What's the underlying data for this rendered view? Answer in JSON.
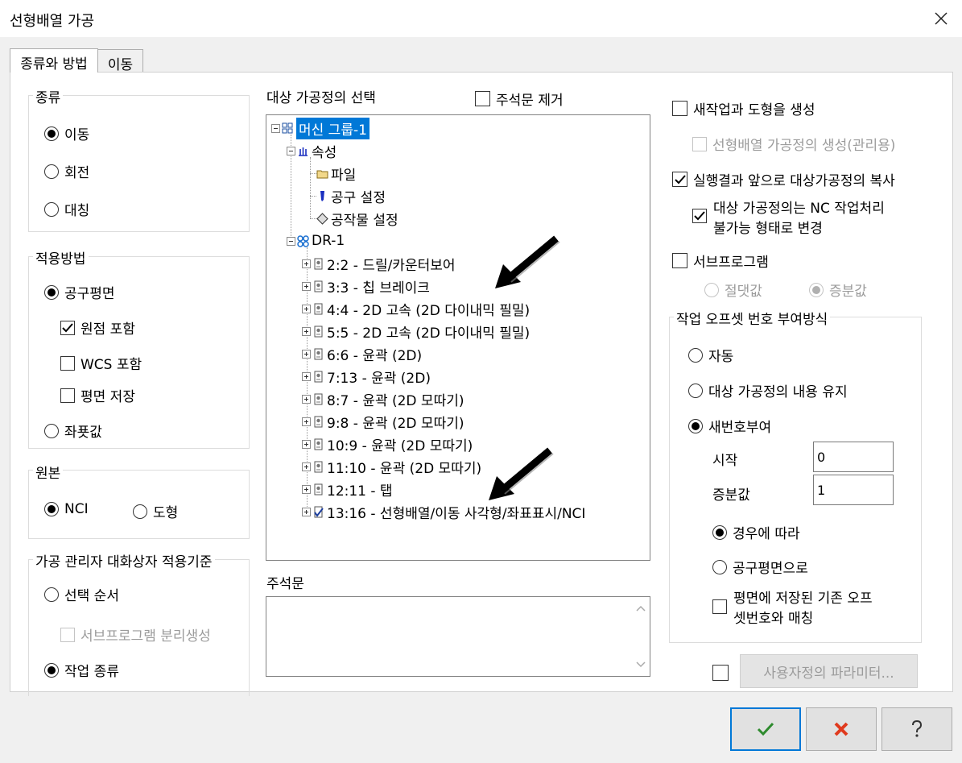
{
  "window": {
    "title": "선형배열 가공"
  },
  "tabs": [
    {
      "label": "종류와 방법",
      "active": true
    },
    {
      "label": "이동",
      "active": false
    }
  ],
  "type_group": {
    "label": "종류",
    "options": [
      {
        "label": "이동",
        "checked": true
      },
      {
        "label": "회전",
        "checked": false
      },
      {
        "label": "대칭",
        "checked": false
      }
    ]
  },
  "method_group": {
    "label": "적용방법",
    "tool_plane": {
      "label": "공구평면",
      "checked": true
    },
    "include_origin": {
      "label": "원점 포함",
      "checked": true
    },
    "include_wcs": {
      "label": "WCS 포함",
      "checked": false
    },
    "save_plane": {
      "label": "평면 저장",
      "checked": false
    },
    "coordinates": {
      "label": "좌푯값",
      "checked": false
    }
  },
  "source_group": {
    "label": "원본",
    "nci": {
      "label": "NCI",
      "checked": true
    },
    "geometry": {
      "label": "도형",
      "checked": false
    }
  },
  "manager_group": {
    "label": "가공 관리자 대화상자 적용기준",
    "select_order": {
      "label": "선택 순서",
      "checked": false
    },
    "subprogram_split": {
      "label": "서브프로그램 분리생성",
      "checked": false,
      "disabled": true
    },
    "operation_type": {
      "label": "작업 종류",
      "checked": true
    }
  },
  "tree_section": {
    "label": "대상 가공정의 선택",
    "remove_comments": {
      "label": "주석문 제거",
      "checked": false
    }
  },
  "tree": {
    "machine_group": "머신 그룹-1",
    "properties": "속성",
    "files": "파일",
    "tool_settings": "공구 설정",
    "stock_settings": "공작물 설정",
    "toolpath_group": "DR-1",
    "operations": [
      "2:2 - 드릴/카운터보어",
      "3:3 - 칩 브레이크",
      "4:4 - 2D 고속 (2D 다이내믹 필밀)",
      "5:5 - 2D 고속 (2D 다이내믹 필밀)",
      "6:6 - 윤곽 (2D)",
      "7:13 - 윤곽 (2D)",
      "8:7 - 윤곽 (2D 모따기)",
      "9:8 - 윤곽 (2D 모따기)",
      "10:9 - 윤곽 (2D 모따기)",
      "11:10 - 윤곽 (2D 모따기)",
      "12:11 - 탭",
      "13:16 - 선형배열/이동 사각형/좌표표시/NCI"
    ]
  },
  "comment_section": {
    "label": "주석문",
    "value": ""
  },
  "right": {
    "create_ops_geometry": {
      "label": "새작업과 도형을 생성",
      "checked": false
    },
    "create_linear_ops": {
      "label": "선형배열 가공정의 생성(관리용)",
      "checked": false,
      "disabled": true
    },
    "copy_results": {
      "label": "실행결과 앞으로 대상가공정의 복사",
      "checked": true
    },
    "nc_disable_line1": "대상 가공정의는 NC 작업처리",
    "nc_disable_line2": "불가능 형태로 변경",
    "nc_disable_checked": true,
    "subprogram": {
      "label": "서브프로그램",
      "checked": false
    },
    "absolute": {
      "label": "절댓값",
      "checked": false,
      "disabled": true
    },
    "incremental": {
      "label": "증분값",
      "checked": true,
      "disabled": true
    }
  },
  "offset_group": {
    "label": "작업 오프셋 번호 부여방식",
    "auto": {
      "label": "자동",
      "checked": false
    },
    "keep": {
      "label": "대상 가공정의 내용 유지",
      "checked": false
    },
    "renumber": {
      "label": "새번호부여",
      "checked": true
    },
    "start": {
      "label": "시작",
      "value": "0"
    },
    "increment": {
      "label": "증분값",
      "value": "1"
    },
    "by_case": {
      "label": "경우에 따라",
      "checked": true
    },
    "by_tool_plane": {
      "label": "공구평면으로",
      "checked": false
    },
    "match_line1": "평면에 저장된 기존 오프",
    "match_line2": "셋번호와 매칭",
    "match_checked": false
  },
  "custom_params": {
    "checked": false,
    "button_label": "사용자정의 파라미터..."
  },
  "footer": {
    "ok_icon": "checkmark-icon",
    "cancel_icon": "x-icon",
    "help_icon": "question-icon"
  },
  "colors": {
    "selection": "#0078d7",
    "ok_green": "#2e8b2e",
    "cancel_red": "#e03a1e"
  }
}
